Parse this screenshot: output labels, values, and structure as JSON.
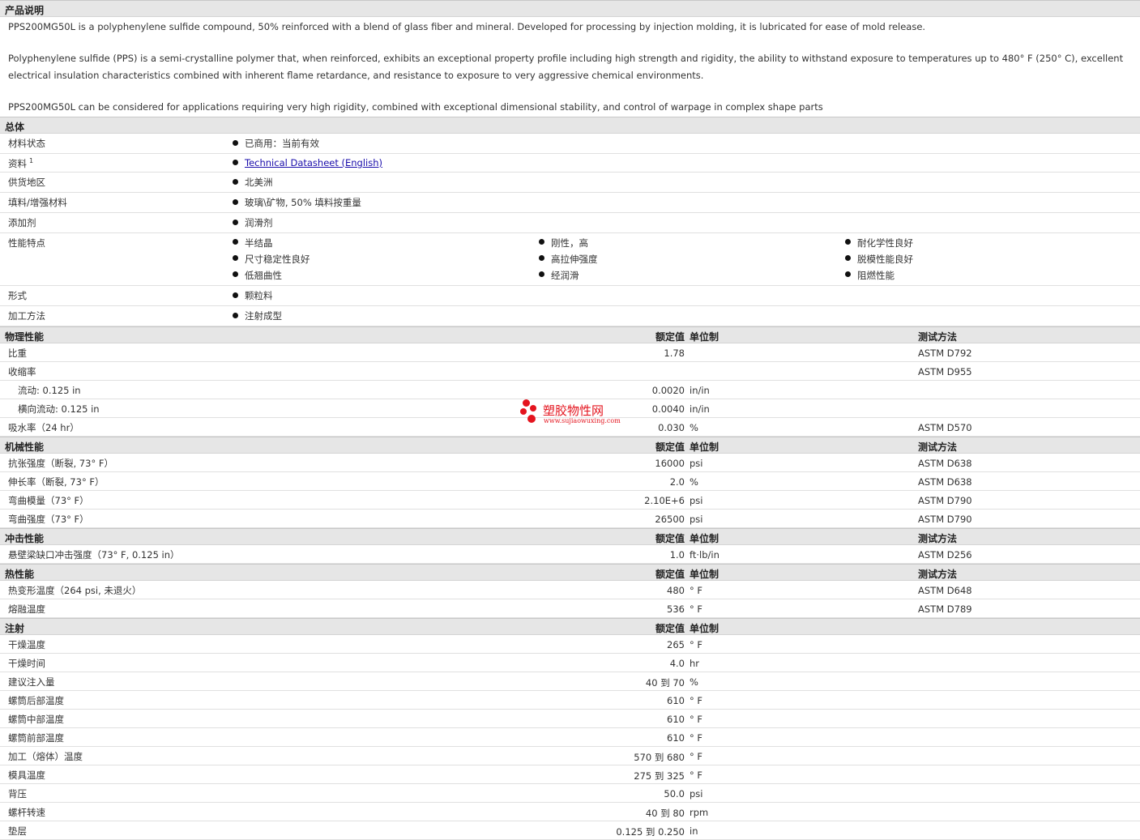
{
  "description": {
    "title": "产品说明",
    "paragraphs": [
      "PPS200MG50L is a polyphenylene sulfide compound, 50% reinforced with a blend of glass fiber and mineral. Developed for processing by injection molding, it is lubricated for ease of mold release.",
      "Polyphenylene sulfide (PPS) is a semi-crystalline polymer that, when reinforced, exhibits an exceptional property profile including high strength and rigidity, the ability to withstand exposure to temperatures up to 480° F (250° C), excellent electrical insulation characteristics combined with inherent flame retardance, and resistance to exposure to very aggressive chemical environments.",
      "PPS200MG50L can be considered for applications requiring very high rigidity, combined with exceptional dimensional stability, and control of warpage in complex shape parts"
    ]
  },
  "general": {
    "title": "总体",
    "rows": [
      {
        "label": "材料状态",
        "items": [
          "已商用：当前有效"
        ]
      },
      {
        "label": "资料",
        "sup": "1",
        "link": "Technical Datasheet (English)"
      },
      {
        "label": "供货地区",
        "items": [
          "北美洲"
        ]
      },
      {
        "label": "填料/增强材料",
        "items": [
          "玻璃\\矿物, 50% 填料按重量"
        ]
      },
      {
        "label": "添加剂",
        "items": [
          "润滑剂"
        ]
      },
      {
        "label": "性能特点",
        "items": [
          "半结晶",
          "刚性，高",
          "耐化学性良好",
          "尺寸稳定性良好",
          "高拉伸强度",
          "脱模性能良好",
          "低翘曲性",
          "经润滑",
          "阻燃性能"
        ]
      },
      {
        "label": "形式",
        "items": [
          "颗粒料"
        ]
      },
      {
        "label": "加工方法",
        "items": [
          "注射成型"
        ]
      }
    ]
  },
  "headers": {
    "value": "额定值",
    "unit": "单位制",
    "test": "测试方法"
  },
  "sections": [
    {
      "title": "物理性能",
      "has_test": true,
      "rows": [
        {
          "label": "比重",
          "value": "1.78",
          "unit": "",
          "test": "ASTM D792"
        },
        {
          "label": "收缩率",
          "value": "",
          "unit": "",
          "test": "ASTM D955"
        },
        {
          "label": "流动: 0.125 in",
          "value": "0.0020",
          "unit": "in/in",
          "test": "",
          "indent": true
        },
        {
          "label": "横向流动: 0.125 in",
          "value": "0.0040",
          "unit": "in/in",
          "test": "",
          "indent": true
        },
        {
          "label": "吸水率（24 hr）",
          "value": "0.030",
          "unit": "%",
          "test": "ASTM D570"
        }
      ]
    },
    {
      "title": "机械性能",
      "has_test": true,
      "rows": [
        {
          "label": "抗张强度（断裂, 73° F）",
          "value": "16000",
          "unit": "psi",
          "test": "ASTM D638"
        },
        {
          "label": "伸长率（断裂, 73° F）",
          "value": "2.0",
          "unit": "%",
          "test": "ASTM D638"
        },
        {
          "label": "弯曲模量（73° F）",
          "value": "2.10E+6",
          "unit": "psi",
          "test": "ASTM D790"
        },
        {
          "label": "弯曲强度（73° F）",
          "value": "26500",
          "unit": "psi",
          "test": "ASTM D790"
        }
      ]
    },
    {
      "title": "冲击性能",
      "has_test": true,
      "rows": [
        {
          "label": "悬壁梁缺口冲击强度（73° F, 0.125 in）",
          "value": "1.0",
          "unit": "ft·lb/in",
          "test": "ASTM D256"
        }
      ]
    },
    {
      "title": "热性能",
      "has_test": true,
      "rows": [
        {
          "label": "热变形温度（264 psi, 未退火）",
          "value": "480",
          "unit": "° F",
          "test": "ASTM D648"
        },
        {
          "label": "熔融温度",
          "value": "536",
          "unit": "° F",
          "test": "ASTM D789"
        }
      ]
    },
    {
      "title": "注射",
      "has_test": false,
      "rows": [
        {
          "label": "干燥温度",
          "value": "265",
          "unit": "° F",
          "test": ""
        },
        {
          "label": "干燥时间",
          "value": "4.0",
          "unit": "hr",
          "test": ""
        },
        {
          "label": "建议注入量",
          "value": "40 到  70",
          "unit": "%",
          "test": ""
        },
        {
          "label": "螺筒后部温度",
          "value": "610",
          "unit": "° F",
          "test": ""
        },
        {
          "label": "螺筒中部温度",
          "value": "610",
          "unit": "° F",
          "test": ""
        },
        {
          "label": "螺筒前部温度",
          "value": "610",
          "unit": "° F",
          "test": ""
        },
        {
          "label": "加工（熔体）温度",
          "value": "570 到  680",
          "unit": "° F",
          "test": ""
        },
        {
          "label": "模具温度",
          "value": "275 到  325",
          "unit": "° F",
          "test": ""
        },
        {
          "label": "背压",
          "value": "50.0",
          "unit": "psi",
          "test": ""
        },
        {
          "label": "螺杆转速",
          "value": "40 到  80",
          "unit": "rpm",
          "test": ""
        },
        {
          "label": "垫层",
          "value": "0.125 到  0.250",
          "unit": "in",
          "test": ""
        }
      ]
    }
  ],
  "watermark": {
    "title": "塑胶物性网",
    "url": "www.sujiaowuxing.com",
    "color": "#e4141e"
  }
}
